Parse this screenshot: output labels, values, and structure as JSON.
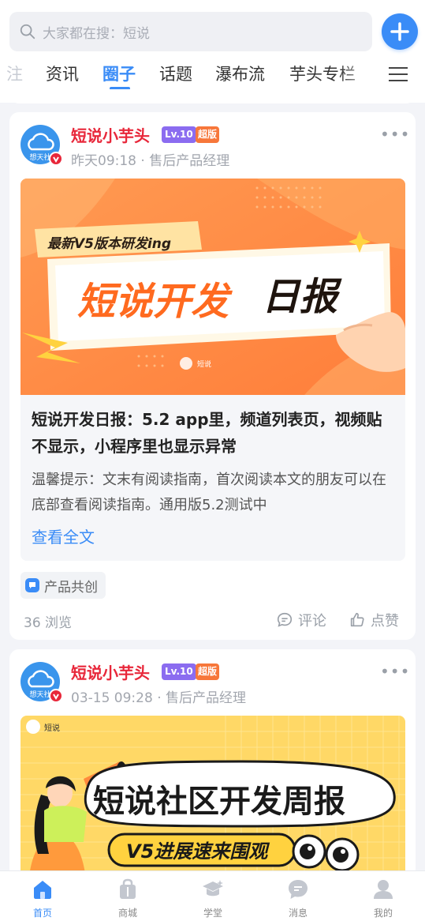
{
  "search": {
    "placeholder": "大家都在搜：短说"
  },
  "tabs": [
    {
      "label": "注"
    },
    {
      "label": "资讯"
    },
    {
      "label": "圈子"
    },
    {
      "label": "话题"
    },
    {
      "label": "瀑布流"
    },
    {
      "label": "芋头专栏"
    }
  ],
  "active_tab": "圈子",
  "posts": [
    {
      "author": "短说小芋头",
      "level": "Lv.10",
      "badge": "超版",
      "avatar_text": "想天社",
      "meta": "昨天09:18 · 售后产品经理",
      "banner": {
        "kicker": "最新V5版本研发ing",
        "headline_a": "短说开发",
        "headline_b": "日报",
        "brand": "短说"
      },
      "title": "短说开发日报：5.2 app里，频道列表页，视频贴不显示，小程序里也显示异常",
      "excerpt": "温馨提示：文末有阅读指南，首次阅读本文的朋友可以在底部查看阅读指南。通用版5.2测试中",
      "read_more": "查看全文",
      "topic": "产品共创",
      "views": "36 浏览",
      "comment_label": "评论",
      "like_label": "点赞"
    },
    {
      "author": "短说小芋头",
      "level": "Lv.10",
      "badge": "超版",
      "avatar_text": "想天社",
      "meta": "03-15 09:28 · 售后产品经理",
      "banner": {
        "brand": "短说",
        "headline": "短说社区开发周报",
        "sub": "V5进展速来围观"
      }
    }
  ],
  "bottom_nav": [
    {
      "label": "首页",
      "icon": "home-icon"
    },
    {
      "label": "商城",
      "icon": "shop-bag-icon"
    },
    {
      "label": "学堂",
      "icon": "graduation-cap-icon"
    },
    {
      "label": "消息",
      "icon": "message-icon"
    },
    {
      "label": "我的",
      "icon": "user-icon"
    }
  ],
  "colors": {
    "accent": "#3a8cf7",
    "author": "#e8273a",
    "level": "#8b6cf0",
    "badge": "#f7773a"
  }
}
